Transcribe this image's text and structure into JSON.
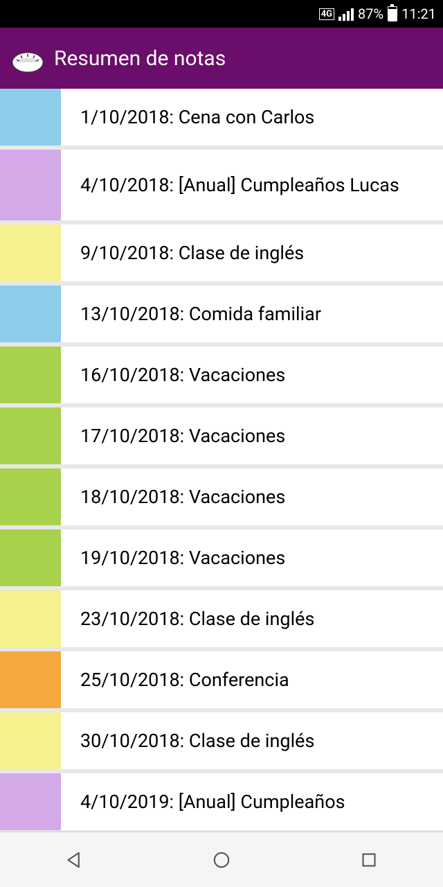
{
  "status": {
    "network": "4G",
    "battery_percent": "87%",
    "time": "11:21"
  },
  "app": {
    "title": "Resumen de notas"
  },
  "colors": {
    "blue": "#8ecde9",
    "purple": "#d3a9e8",
    "yellow": "#f5f18f",
    "green": "#a8d24b",
    "orange": "#f5a83d"
  },
  "notes": [
    {
      "color": "blue",
      "text": "1/10/2018: Cena con Carlos"
    },
    {
      "color": "purple",
      "text": "4/10/2018: [Anual] Cumpleaños Lucas"
    },
    {
      "color": "yellow",
      "text": "9/10/2018: Clase de inglés"
    },
    {
      "color": "blue",
      "text": "13/10/2018: Comida familiar"
    },
    {
      "color": "green",
      "text": "16/10/2018: Vacaciones"
    },
    {
      "color": "green",
      "text": "17/10/2018: Vacaciones"
    },
    {
      "color": "green",
      "text": "18/10/2018: Vacaciones"
    },
    {
      "color": "green",
      "text": "19/10/2018: Vacaciones"
    },
    {
      "color": "yellow",
      "text": "23/10/2018: Clase de inglés"
    },
    {
      "color": "orange",
      "text": "25/10/2018: Conferencia"
    },
    {
      "color": "yellow",
      "text": "30/10/2018: Clase de inglés"
    },
    {
      "color": "purple",
      "text": "4/10/2019: [Anual] Cumpleaños"
    }
  ]
}
